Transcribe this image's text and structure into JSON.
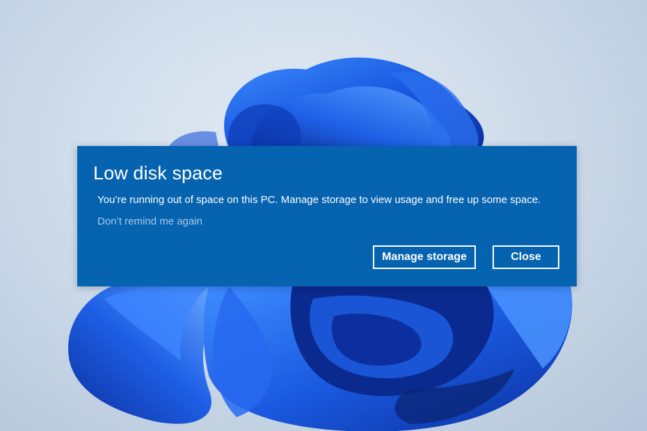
{
  "notification": {
    "title": "Low disk space",
    "message": "You’re running out of space on this PC. Manage storage to view usage and free up some space.",
    "dismiss_link": "Don’t remind me again",
    "buttons": {
      "manage_storage": "Manage storage",
      "close": "Close"
    },
    "background_color": "#0563b0",
    "link_color": "#a9c9ea"
  },
  "wallpaper": {
    "description_icon": "windows-11-bloom",
    "accent": "#1a5ae0"
  }
}
